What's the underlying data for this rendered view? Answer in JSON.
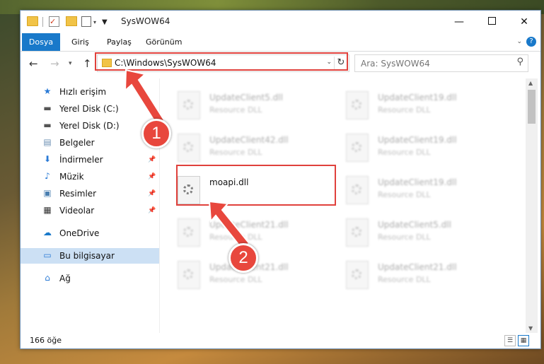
{
  "window": {
    "title": "SysWOW64"
  },
  "ribbon": {
    "tabs": [
      "Dosya",
      "Giriş",
      "Paylaş",
      "Görünüm"
    ]
  },
  "address": {
    "path": "C:\\Windows\\SysWOW64"
  },
  "search": {
    "placeholder": "Ara: SysWOW64"
  },
  "sidebar": {
    "items": [
      {
        "label": "Hızlı erişim",
        "icon": "star-icon"
      },
      {
        "label": "Yerel Disk (C:)",
        "icon": "drive-icon"
      },
      {
        "label": "Yerel Disk (D:)",
        "icon": "drive-icon"
      },
      {
        "label": "Belgeler",
        "icon": "documents-icon"
      },
      {
        "label": "İndirmeler",
        "icon": "download-icon"
      },
      {
        "label": "Müzik",
        "icon": "music-icon"
      },
      {
        "label": "Resimler",
        "icon": "pictures-icon"
      },
      {
        "label": "Videolar",
        "icon": "videos-icon"
      },
      {
        "label": "OneDrive",
        "icon": "cloud-icon"
      },
      {
        "label": "Bu bilgisayar",
        "icon": "computer-icon"
      },
      {
        "label": "Ağ",
        "icon": "network-icon"
      }
    ]
  },
  "files": [
    {
      "name": "UpdateClient5.dll",
      "type": "Resource DLL"
    },
    {
      "name": "UpdateClient19.dll",
      "type": "Resource DLL"
    },
    {
      "name": "UpdateClient42.dll",
      "type": "Resource DLL"
    },
    {
      "name": "UpdateClient19.dll",
      "type": "Resource DLL"
    },
    {
      "name": "moapi.dll",
      "type": ""
    },
    {
      "name": "UpdateClient19.dll",
      "type": "Resource DLL"
    },
    {
      "name": "UpdateClient21.dll",
      "type": "Resource DLL"
    },
    {
      "name": "UpdateClient5.dll",
      "type": "Resource DLL"
    },
    {
      "name": "UpdateClient21.dll",
      "type": "Resource DLL"
    },
    {
      "name": "UpdateClient21.dll",
      "type": "Resource DLL"
    }
  ],
  "status": {
    "count": "166 öğe"
  },
  "annotations": {
    "step1": "1",
    "step2": "2",
    "highlight_color": "#e0413c"
  }
}
